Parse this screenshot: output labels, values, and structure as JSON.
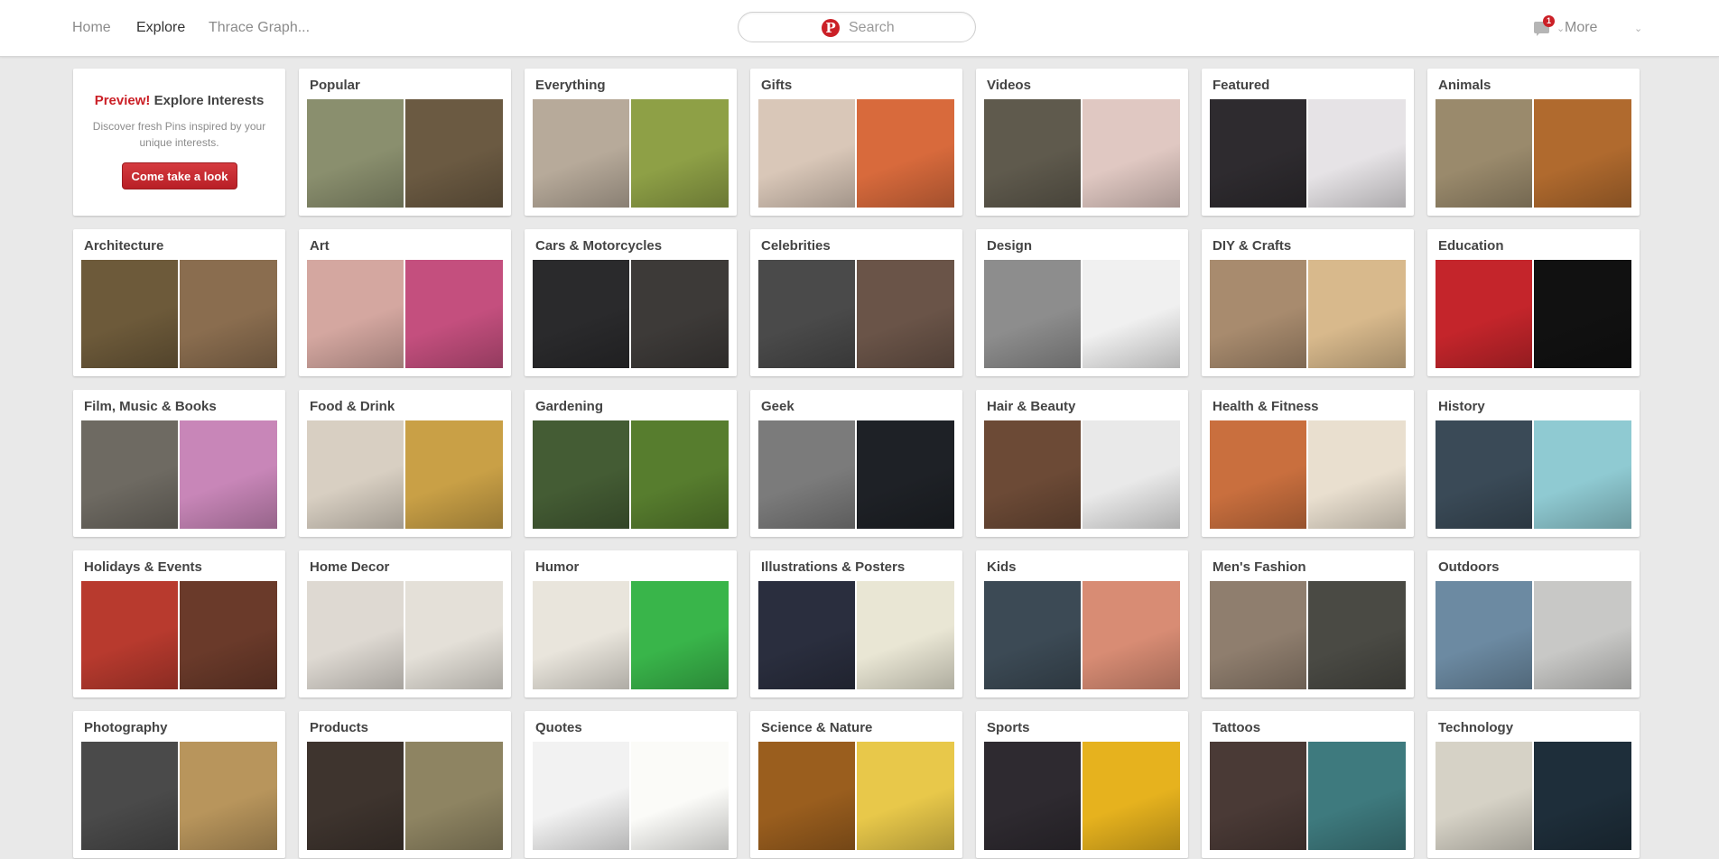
{
  "nav": {
    "home": "Home",
    "explore": "Explore",
    "board": "Thrace Graph...",
    "more": "More"
  },
  "search": {
    "placeholder": "Search",
    "logo": "P"
  },
  "notifications": {
    "count": "1"
  },
  "preview": {
    "highlight": "Preview!",
    "title_rest": " Explore Interests",
    "description": "Discover fresh Pins inspired by your unique interests.",
    "button": "Come take a look"
  },
  "categories": [
    {
      "title": "Popular",
      "c1": "#8a8f6e",
      "c2": "#6b5a42"
    },
    {
      "title": "Everything",
      "c1": "#b7aa9a",
      "c2": "#8ea046"
    },
    {
      "title": "Gifts",
      "c1": "#d9c7b8",
      "c2": "#d86a3c"
    },
    {
      "title": "Videos",
      "c1": "#5f5a4d",
      "c2": "#e0c8c2"
    },
    {
      "title": "Featured",
      "c1": "#2e2b2f",
      "c2": "#e6e3e6"
    },
    {
      "title": "Animals",
      "c1": "#9a8a6c",
      "c2": "#b06a2e"
    },
    {
      "title": "Architecture",
      "c1": "#6d5a3a",
      "c2": "#8a6d4f"
    },
    {
      "title": "Art",
      "c1": "#d4a7a0",
      "c2": "#c44f7e"
    },
    {
      "title": "Cars & Motorcycles",
      "c1": "#2a2a2c",
      "c2": "#3d3a38"
    },
    {
      "title": "Celebrities",
      "c1": "#4a4a4a",
      "c2": "#6a5448"
    },
    {
      "title": "Design",
      "c1": "#8d8d8d",
      "c2": "#f0f0f0"
    },
    {
      "title": "DIY & Crafts",
      "c1": "#a88b6e",
      "c2": "#d8b98c"
    },
    {
      "title": "Education",
      "c1": "#c4252b",
      "c2": "#111111"
    },
    {
      "title": "Film, Music & Books",
      "c1": "#6e6a62",
      "c2": "#c886b8"
    },
    {
      "title": "Food & Drink",
      "c1": "#d8cfc2",
      "c2": "#c9a046"
    },
    {
      "title": "Gardening",
      "c1": "#445c34",
      "c2": "#577d2e"
    },
    {
      "title": "Geek",
      "c1": "#7b7b7b",
      "c2": "#1e2126"
    },
    {
      "title": "Hair & Beauty",
      "c1": "#6c4a36",
      "c2": "#e9e9e9"
    },
    {
      "title": "Health & Fitness",
      "c1": "#c96f3e",
      "c2": "#e9dfcf"
    },
    {
      "title": "History",
      "c1": "#3a4a57",
      "c2": "#8fcad2"
    },
    {
      "title": "Holidays & Events",
      "c1": "#b83a2e",
      "c2": "#6a3a2a"
    },
    {
      "title": "Home Decor",
      "c1": "#ded9d2",
      "c2": "#e4e0d8"
    },
    {
      "title": "Humor",
      "c1": "#e9e5dc",
      "c2": "#39b54a"
    },
    {
      "title": "Illustrations & Posters",
      "c1": "#2a2e3e",
      "c2": "#e9e6d4"
    },
    {
      "title": "Kids",
      "c1": "#3c4a55",
      "c2": "#d88c74"
    },
    {
      "title": "Men's Fashion",
      "c1": "#8f7e6e",
      "c2": "#4a4a44"
    },
    {
      "title": "Outdoors",
      "c1": "#6c8aa2",
      "c2": "#c8c8c6"
    },
    {
      "title": "Photography",
      "c1": "#4a4a4a",
      "c2": "#b8955c"
    },
    {
      "title": "Products",
      "c1": "#3e342e",
      "c2": "#8e8462"
    },
    {
      "title": "Quotes",
      "c1": "#f2f2f2",
      "c2": "#fbfbf8"
    },
    {
      "title": "Science & Nature",
      "c1": "#9a5e1e",
      "c2": "#e8c84a"
    },
    {
      "title": "Sports",
      "c1": "#2e2a30",
      "c2": "#e6b21e"
    },
    {
      "title": "Tattoos",
      "c1": "#4a3a36",
      "c2": "#3e7a7e"
    },
    {
      "title": "Technology",
      "c1": "#d6d2c6",
      "c2": "#1e2e3a"
    }
  ]
}
